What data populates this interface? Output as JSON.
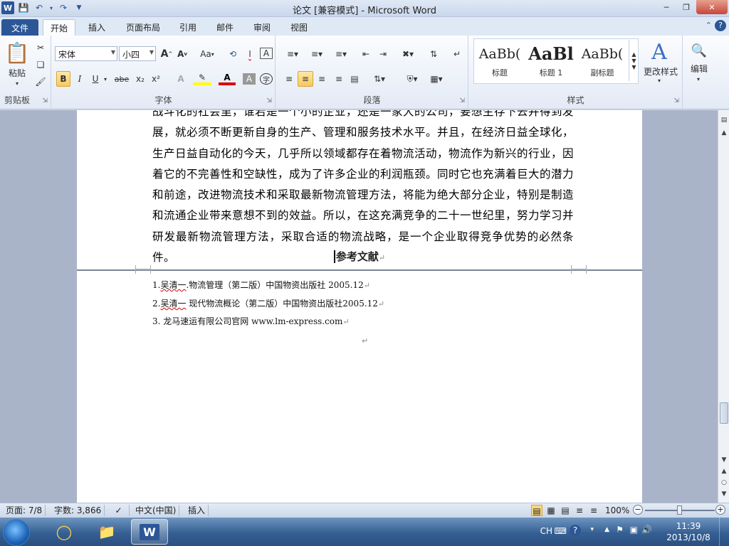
{
  "window": {
    "title": "论文 [兼容模式] - Microsoft Word"
  },
  "tabs": [
    "文件",
    "开始",
    "插入",
    "页面布局",
    "引用",
    "邮件",
    "审阅",
    "视图"
  ],
  "ribbon": {
    "clipboard": {
      "paste_label": "粘贴",
      "group_label": "剪贴板"
    },
    "font": {
      "group_label": "字体",
      "font_name": "宋体",
      "font_size": "小四",
      "grow": "A",
      "shrink": "A",
      "change_case": "Aa",
      "bold": "B",
      "italic": "I",
      "underline": "U",
      "strike": "abe",
      "subscript": "x₂",
      "superscript": "x²"
    },
    "paragraph": {
      "group_label": "段落"
    },
    "styles": {
      "group_label": "样式",
      "items": [
        {
          "preview": "AaBb(",
          "name": "标题"
        },
        {
          "preview": "AaBl",
          "name": "标题 1"
        },
        {
          "preview": "AaBb(",
          "name": "副标题"
        }
      ],
      "change_styles": "更改样式"
    },
    "editing": {
      "label": "编辑"
    }
  },
  "document": {
    "paragraph": [
      "战斗化的社会里，谁若是一个小的企业，还是一家大的公司，要想生存下去并得到发",
      "展，就必须不断更新自身的生产、管理和服务技术水平。并且，在经济日益全球化，",
      "生产日益自动化的今天，几乎所以领域都存在着物流活动，物流作为新兴的行业，因",
      "着它的不完善性和空缺性，成为了许多企业的利润瓶颈。同时它也充满着巨大的潜力",
      "和前途，改进物流技术和采取最新物流管理方法，将能为绝大部分企业，特别是制造",
      "和流通企业带来意想不到的效益。所以，在这充满竞争的二十一世纪里，努力学习并",
      "研发最新物流管理方法，采取合适的物流战略，是一个企业取得竞争优势的必然条件。"
    ],
    "ref_heading": "参考文献",
    "references": [
      {
        "num": "1.",
        "author": "吴清一",
        "rest": ".物流管理（第二版）中国物资出版社  2005.12"
      },
      {
        "num": "2.",
        "author": "吴清一",
        "rest": " 现代物流概论（第二版）中国物资出版社2005.12"
      },
      {
        "num": "3.",
        "author": "",
        "rest": " 龙马速运有限公司官网  www.lm-express.com"
      }
    ]
  },
  "status": {
    "page": "页面: 7/8",
    "words": "字数: 3,866",
    "language": "中文(中国)",
    "insert": "插入",
    "zoom": "100%",
    "zoom_fraction": 0.5
  },
  "taskbar": {
    "ime": "CH",
    "time": "11:39",
    "date": "2013/10/8"
  }
}
